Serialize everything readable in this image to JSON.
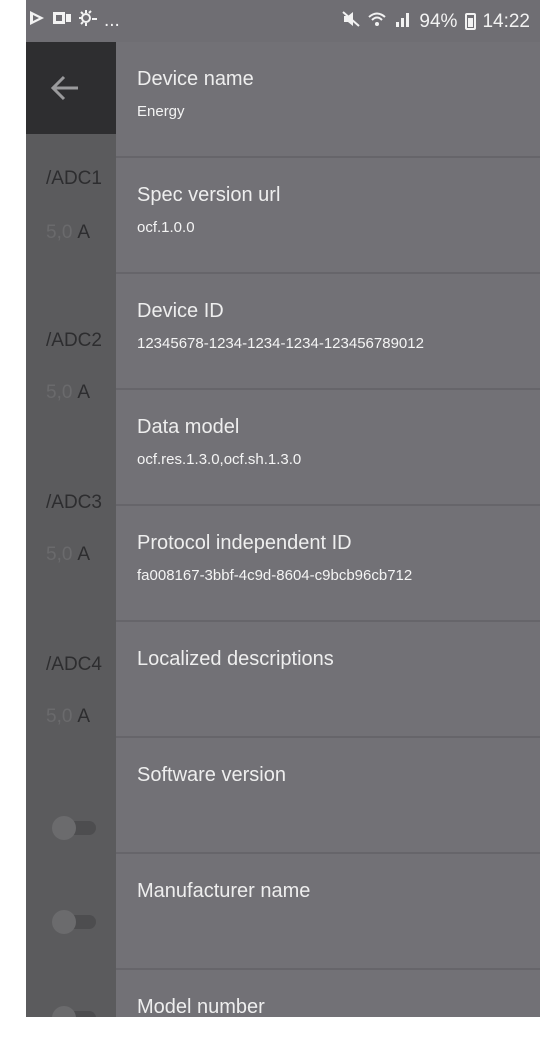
{
  "status_bar": {
    "left_icons": [
      "play-store-icon",
      "media-icon",
      "weather-icon"
    ],
    "overflow": "...",
    "mute_icon": "mute-icon",
    "wifi_icon": "wifi-icon",
    "signal_icon": "signal-icon",
    "battery_percent": "94%",
    "time": "14:22"
  },
  "background": {
    "items": [
      {
        "label": "/ADC1",
        "value": "5,0",
        "unit": "A"
      },
      {
        "label": "/ADC2",
        "value": "5,0",
        "unit": "A"
      },
      {
        "label": "/ADC3",
        "value": "5,0",
        "unit": "A"
      },
      {
        "label": "/ADC4",
        "value": "5,0",
        "unit": "A"
      }
    ]
  },
  "drawer": {
    "items": [
      {
        "title": "Device name",
        "value": "Energy"
      },
      {
        "title": "Spec version url",
        "value": "ocf.1.0.0"
      },
      {
        "title": "Device ID",
        "value": "12345678-1234-1234-1234-123456789012"
      },
      {
        "title": "Data model",
        "value": "ocf.res.1.3.0,ocf.sh.1.3.0"
      },
      {
        "title": "Protocol independent ID",
        "value": "fa008167-3bbf-4c9d-8604-c9bcb96cb712"
      },
      {
        "title": "Localized descriptions",
        "value": ""
      },
      {
        "title": "Software version",
        "value": ""
      },
      {
        "title": "Manufacturer name",
        "value": ""
      },
      {
        "title": "Model number",
        "value": ""
      }
    ]
  },
  "colors": {
    "status_bar": "#6f6e73",
    "drawer_bg": "#727176",
    "app_bar": "#2e2e30",
    "dim_bg": "#5b5b5d"
  }
}
